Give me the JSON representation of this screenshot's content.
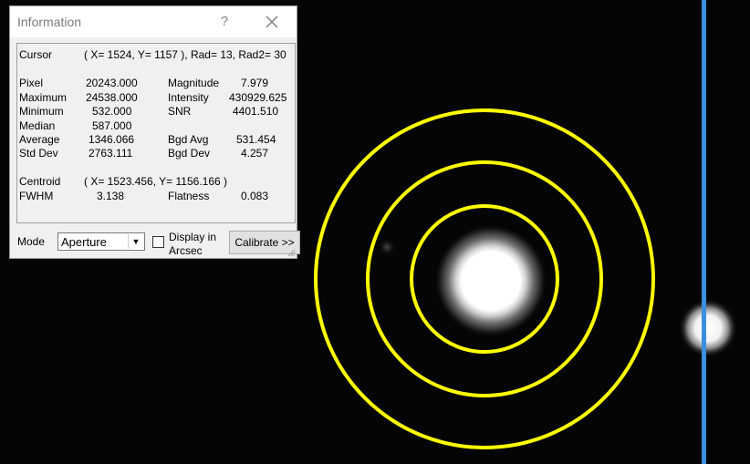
{
  "dialog": {
    "title": "Information",
    "help_glyph": "?",
    "close_icon": "close-icon"
  },
  "info": {
    "cursor_label": "Cursor",
    "cursor_value": "( X= 1524, Y= 1157 ), Rad= 13, Rad2= 30",
    "pixel_label": "Pixel",
    "pixel_value": "20243.000",
    "magnitude_label": "Magnitude",
    "magnitude_value": "7.979",
    "maximum_label": "Maximum",
    "maximum_value": "24538.000",
    "intensity_label": "Intensity",
    "intensity_value": "430929.625",
    "minimum_label": "Minimum",
    "minimum_value": "532.000",
    "snr_label": "SNR",
    "snr_value": "4401.510",
    "median_label": "Median",
    "median_value": "587.000",
    "average_label": "Average",
    "average_value": "1346.066",
    "bgd_avg_label": "Bgd Avg",
    "bgd_avg_value": "531.454",
    "stddev_label": "Std Dev",
    "stddev_value": "2763.111",
    "bgd_dev_label": "Bgd Dev",
    "bgd_dev_value": "4.257",
    "centroid_label": "Centroid",
    "centroid_value": "( X= 1523.456, Y= 1156.166 )",
    "fwhm_label": "FWHM",
    "fwhm_value": "3.138",
    "flatness_label": "Flatness",
    "flatness_value": "0.083"
  },
  "controls": {
    "mode_label": "Mode",
    "mode_value": "Aperture",
    "display_line1": "Display in",
    "display_line2": "Arcsec",
    "display_checked": false,
    "calibrate_label": "Calibrate >>"
  },
  "colors": {
    "aperture_rings": "#ffff00",
    "marker_line": "#3c8ee0",
    "background": "#050505"
  }
}
